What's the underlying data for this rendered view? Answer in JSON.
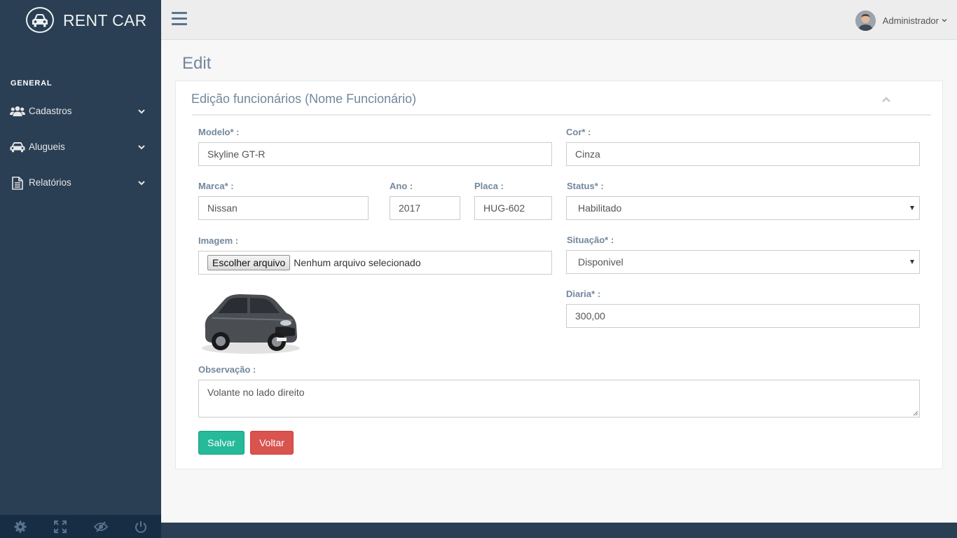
{
  "brand": {
    "title": "RENT CAR",
    "logo_icon": "car-icon"
  },
  "sidebar": {
    "section_title": "GENERAL",
    "items": [
      {
        "label": "Cadastros",
        "icon": "users-icon"
      },
      {
        "label": "Alugueis",
        "icon": "car-icon"
      },
      {
        "label": "Relatórios",
        "icon": "document-icon"
      }
    ],
    "footer_icons": [
      "settings-icon",
      "fullscreen-icon",
      "eye-slash-icon",
      "power-icon"
    ]
  },
  "topnav": {
    "user_name": "Administrador"
  },
  "page": {
    "title": "Edit"
  },
  "panel": {
    "title": "Edição funcionários (Nome Funcionário)"
  },
  "form": {
    "modelo": {
      "label": "Modelo* :",
      "value": "Skyline GT-R"
    },
    "cor": {
      "label": "Cor* :",
      "value": "Cinza"
    },
    "marca": {
      "label": "Marca* :",
      "value": "Nissan"
    },
    "ano": {
      "label": "Ano :",
      "value": "2017"
    },
    "placa": {
      "label": "Placa :",
      "value": "HUG-602"
    },
    "status": {
      "label": "Status* :",
      "value": "Habilitado"
    },
    "imagem": {
      "label": "Imagem :",
      "button": "Escolher arquivo",
      "file_text": "Nenhum arquivo selecionado"
    },
    "situacao": {
      "label": "Situação* :",
      "value": "Disponivel"
    },
    "diaria": {
      "label": "Diaria* :",
      "value": "300,00"
    },
    "observacao": {
      "label": "Observação :",
      "value": "Volante no lado direito"
    }
  },
  "buttons": {
    "save": "Salvar",
    "back": "Voltar"
  },
  "colors": {
    "sidebar": "#2A3F54",
    "success": "#26B99A",
    "danger": "#D9534F",
    "text": "#73879C"
  }
}
